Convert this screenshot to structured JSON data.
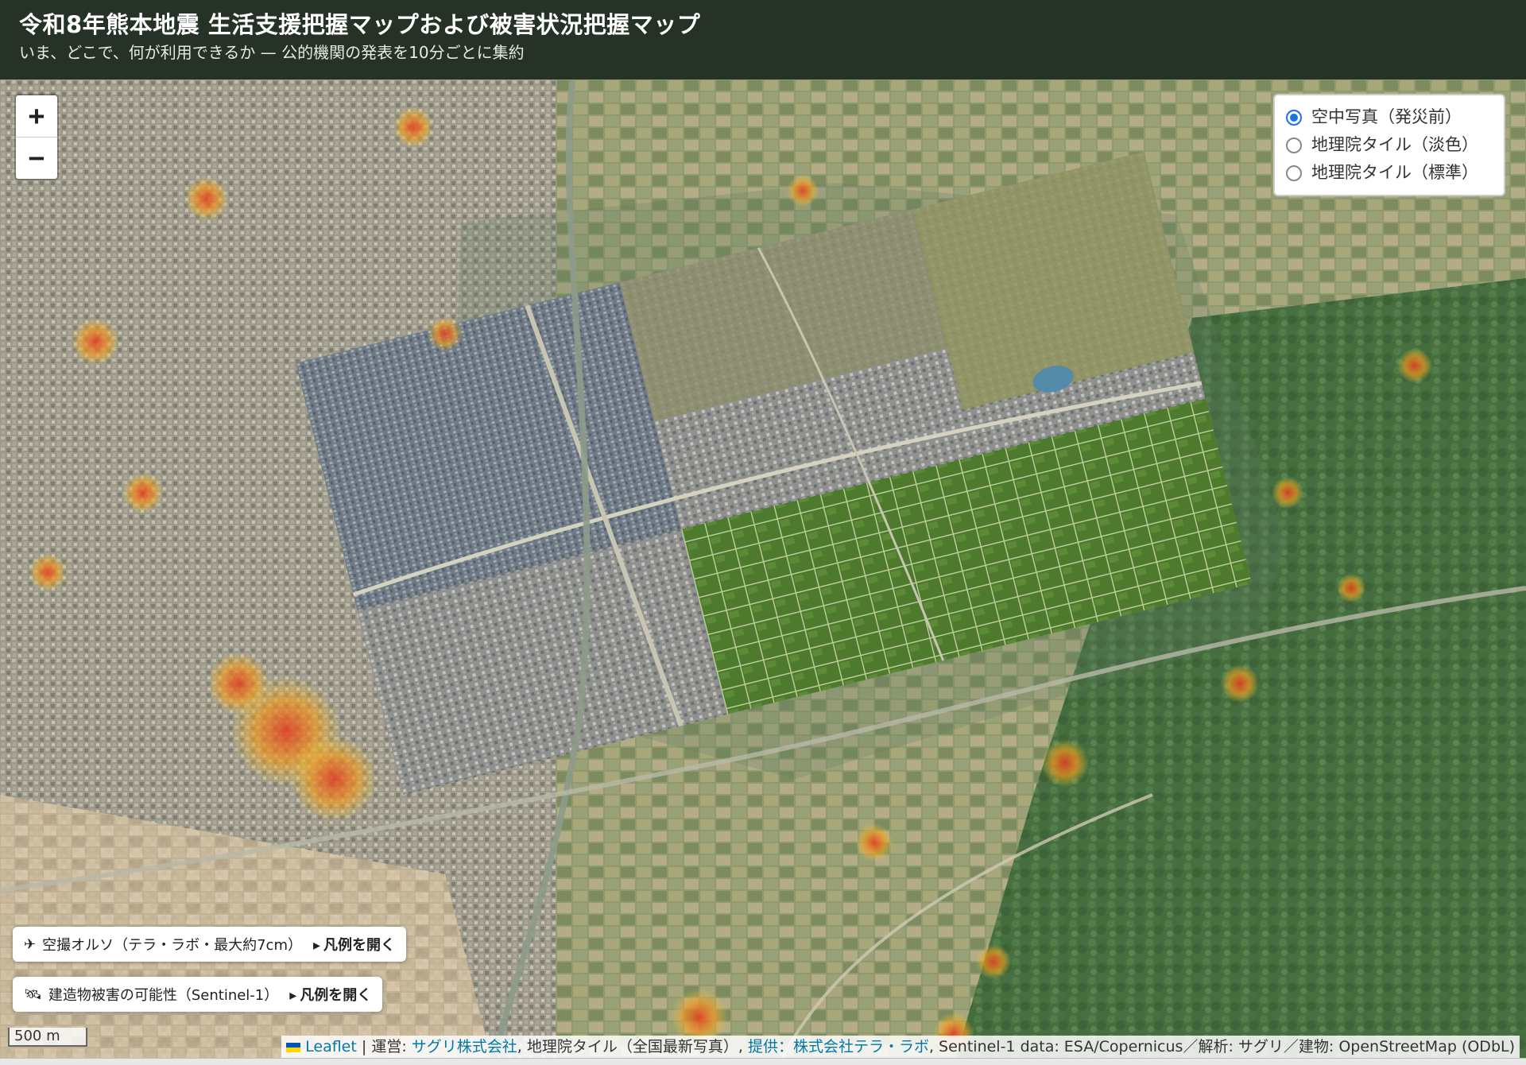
{
  "header": {
    "title": "令和8年熊本地震 生活支援把握マップおよび被害状況把握マップ",
    "subtitle": "いま、どこで、何が利用できるか — 公的機関の発表を10分ごとに集約"
  },
  "zoom": {
    "in_label": "+",
    "out_label": "−"
  },
  "layer_control": {
    "options": [
      {
        "label": "空中写真（発災前）",
        "selected": true
      },
      {
        "label": "地理院タイル（淡色）",
        "selected": false
      },
      {
        "label": "地理院タイル（標準）",
        "selected": false
      }
    ]
  },
  "legends": [
    {
      "icon": "airplane-icon",
      "label": "空撮オルソ（テラ・ラボ・最大約7cm）",
      "open_label": "凡例を開く"
    },
    {
      "icon": "satellite-icon",
      "label": "建造物被害の可能性（Sentinel-1）",
      "open_label": "凡例を開く"
    }
  ],
  "scale": {
    "label": "500 m"
  },
  "attribution": {
    "leaflet": "Leaflet",
    "operator_prefix": "| 運営: ",
    "operator": "サグリ株式会社",
    "tiles": ", 地理院タイル（全国最新写真）, ",
    "provider": "提供：株式会社テラ・ラボ",
    "rest": ", Sentinel-1 data: ESA/Copernicus／解析: サグリ／建物: OpenStreetMap (ODbL)"
  }
}
